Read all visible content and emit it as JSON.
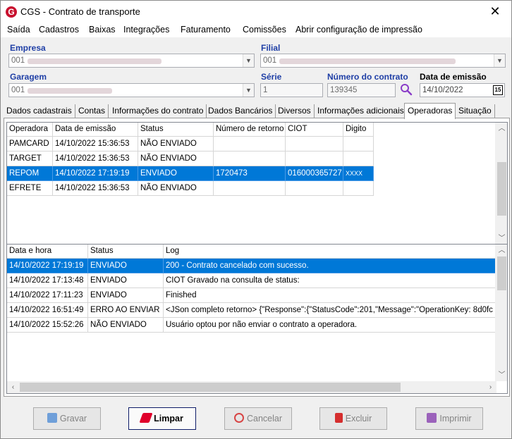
{
  "window": {
    "title": "CGS - Contrato de transporte",
    "app_icon": "G"
  },
  "menu": [
    "Saída",
    "Cadastros",
    "Baixas",
    "Integrações",
    "Faturamento",
    "Comissões",
    "Abrir configuração de impressão"
  ],
  "form": {
    "empresa_label": "Empresa",
    "empresa_value": "001",
    "filial_label": "Filial",
    "filial_value": "001",
    "garagem_label": "Garagem",
    "garagem_value": "001",
    "serie_label": "Série",
    "serie_value": "1",
    "contrato_label": "Número do contrato",
    "contrato_value": "139345",
    "emissao_label": "Data de emissão",
    "emissao_value": "14/10/2022",
    "cal_icon_text": "15"
  },
  "tabs": [
    "Dados cadastrais",
    "Contas",
    "Informações do contrato",
    "Dados Bancários",
    "Diversos",
    "Informações adicionais",
    "Operadoras",
    "Situação"
  ],
  "active_tab": "Operadoras",
  "operadoras": {
    "columns": [
      "Operadora",
      "Data de emissão",
      "Status",
      "Número de retorno",
      "CIOT",
      "Digito"
    ],
    "rows": [
      [
        "PAMCARD",
        "14/10/2022 15:36:53",
        "NÃO ENVIADO",
        "",
        "",
        ""
      ],
      [
        "TARGET",
        "14/10/2022 15:36:53",
        "NÃO ENVIADO",
        "",
        "",
        ""
      ],
      [
        "REPOM",
        "14/10/2022 17:19:19",
        "ENVIADO",
        "1720473",
        "016000365727",
        "XXXX"
      ],
      [
        "EFRETE",
        "14/10/2022 15:36:53",
        "NÃO ENVIADO",
        "",
        "",
        ""
      ]
    ],
    "selected_index": 2
  },
  "log": {
    "columns": [
      "Data e hora",
      "Status",
      "Log"
    ],
    "rows": [
      [
        "14/10/2022 17:19:19",
        "ENVIADO",
        "200 - Contrato cancelado com sucesso."
      ],
      [
        "14/10/2022 17:13:48",
        "ENVIADO",
        " CIOT Gravado na consulta de status:"
      ],
      [
        "14/10/2022 17:11:23",
        "ENVIADO",
        "Finished"
      ],
      [
        "14/10/2022 16:51:49",
        "ERRO AO ENVIAR",
        "<JSon completo retorno> {\"Response\":{\"StatusCode\":201,\"Message\":\"OperationKey: 8d0fc"
      ],
      [
        "14/10/2022 15:52:26",
        "NÃO ENVIADO",
        "Usuário optou por não enviar o contrato a operadora."
      ]
    ],
    "selected_index": 0
  },
  "buttons": {
    "gravar": "Gravar",
    "limpar": "Limpar",
    "cancelar": "Cancelar",
    "excluir": "Excluir",
    "imprimir": "Imprimir"
  },
  "colors": {
    "selection": "#0078d7",
    "label_blue": "#1f3fa6",
    "limpar_icon": "#e0002b",
    "excluir_icon": "#d10000",
    "imprimir_icon": "#7a2aa8",
    "gravar_icon": "#1f6fd1",
    "cancelar_icon": "#d10000"
  }
}
